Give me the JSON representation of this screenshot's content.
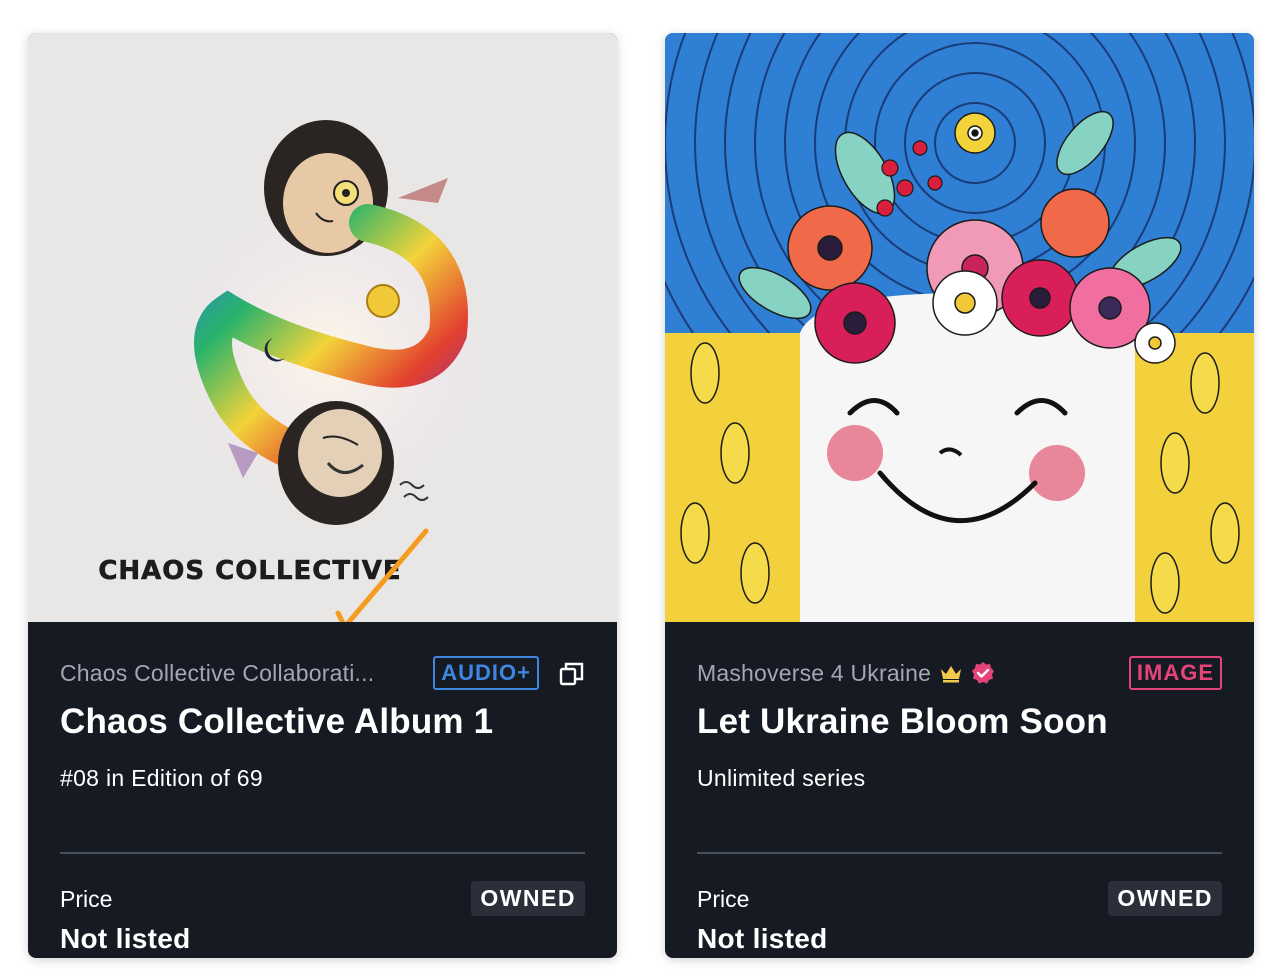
{
  "cards": [
    {
      "artwork_caption": "CHAOS COLLECTIVE",
      "collection": "Chaos Collective Collaborati...",
      "type_tag": "AUDIO+",
      "title": "Chaos Collective Album 1",
      "edition": "#08 in Edition of 69",
      "price_label": "Price",
      "price_value": "Not listed",
      "status": "OWNED",
      "icons": [
        "copies-icon"
      ]
    },
    {
      "collection": "Mashoverse 4 Ukraine",
      "type_tag": "IMAGE",
      "title": "Let Ukraine Bloom Soon",
      "edition": "Unlimited series",
      "price_label": "Price",
      "price_value": "Not listed",
      "status": "OWNED",
      "icons": [
        "crown-icon",
        "verified-icon"
      ]
    }
  ],
  "colors": {
    "card_bg": "#161a23",
    "audio_tag": "#3f86e0",
    "image_tag": "#e5447a",
    "crown": "#f2c94c",
    "verified": "#e5447a",
    "annotation_arrow": "#f39c1f"
  }
}
